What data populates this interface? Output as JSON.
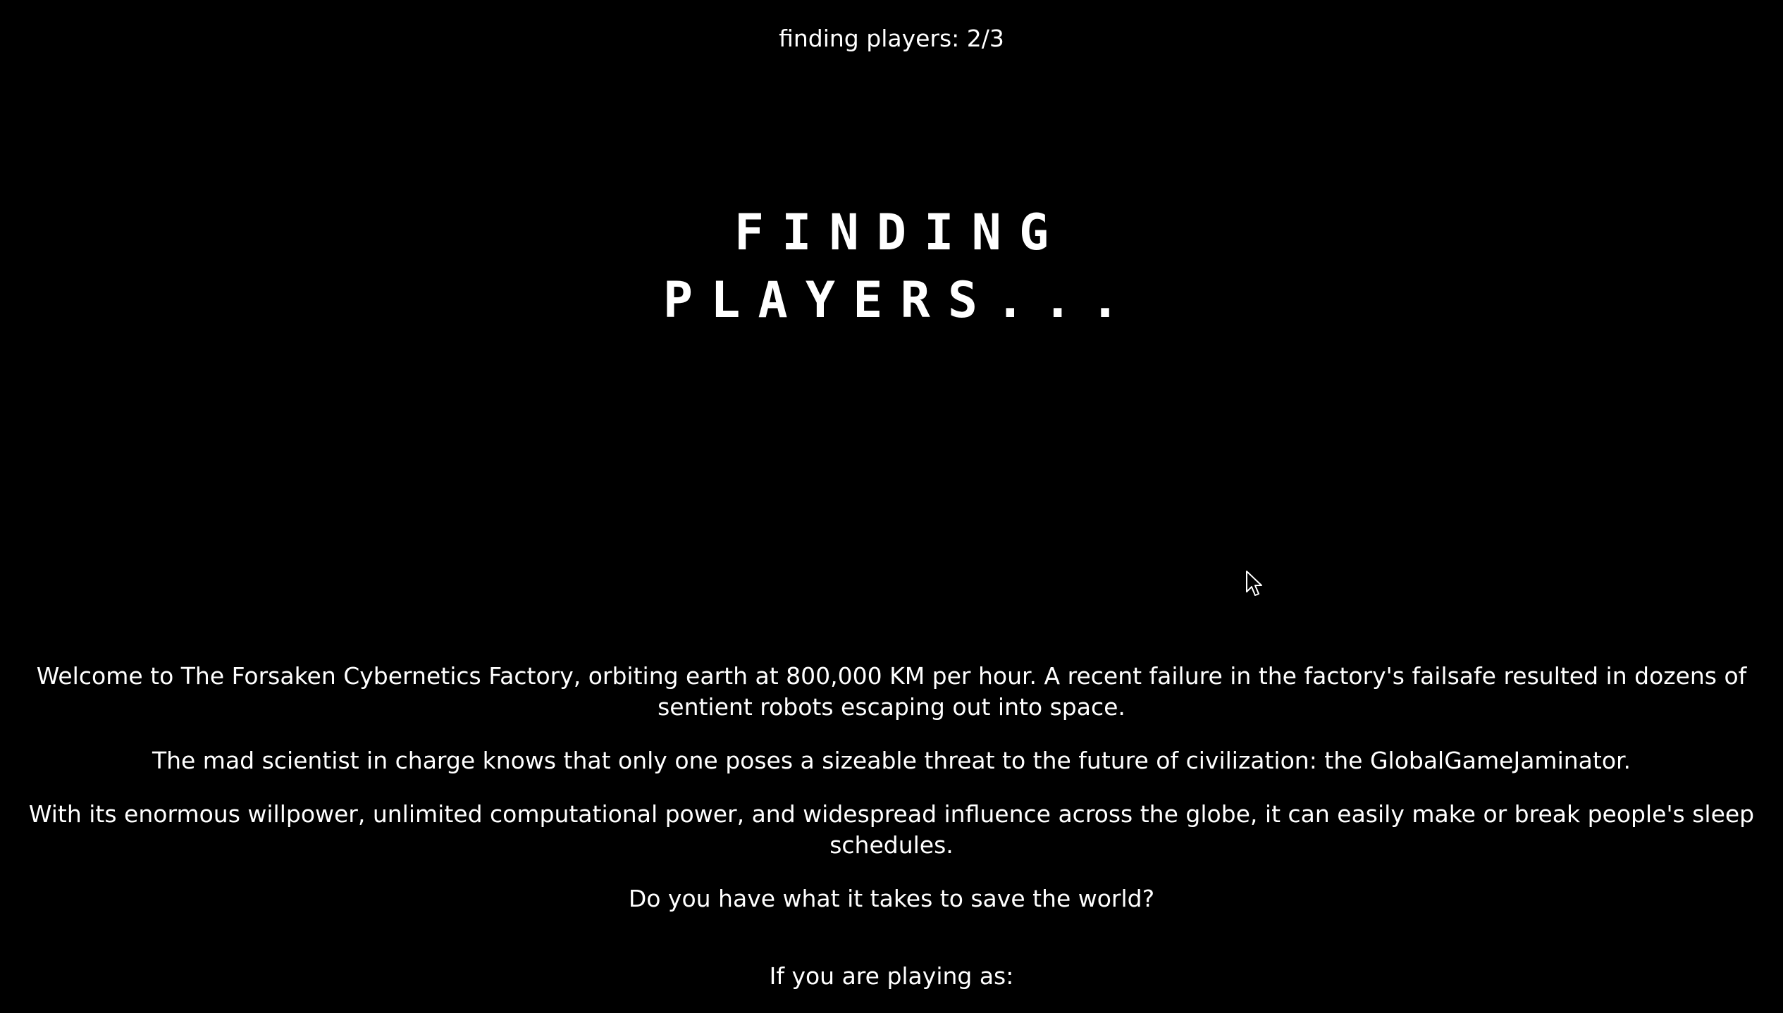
{
  "status": {
    "label": "finding players: 2/3"
  },
  "title": {
    "line1": "FINDING",
    "line2": "PLAYERS..."
  },
  "story": {
    "paragraphs": [
      "Welcome to The Forsaken Cybernetics Factory, orbiting earth at 800,000 KM per hour. A recent failure in the factory's failsafe resulted in dozens of sentient robots escaping out into space.",
      "The mad scientist in charge knows that only one poses a sizeable threat to the future of civilization: the GlobalGameJaminator.",
      "With its enormous willpower, unlimited computational power, and widespread influence across the globe, it can easily make or break people's sleep schedules.",
      "Do you have what it takes to save the world?"
    ]
  },
  "prompt": {
    "label": "If you are playing as:"
  },
  "colors": {
    "background": "#000000",
    "text": "#ffffff"
  },
  "icons": {
    "cursor": "mouse-pointer-icon"
  }
}
